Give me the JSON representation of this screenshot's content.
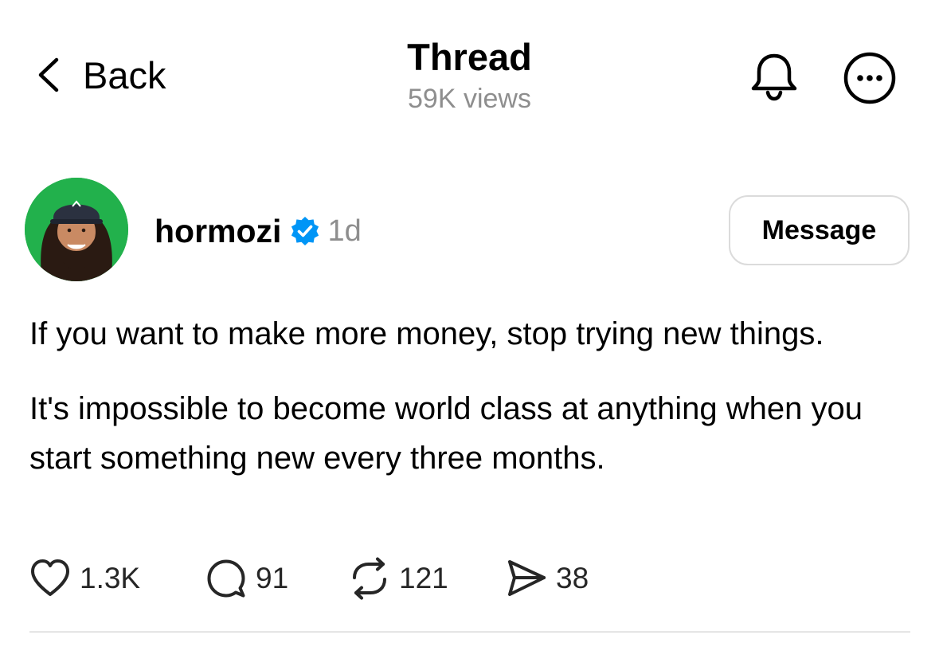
{
  "header": {
    "back_label": "Back",
    "title": "Thread",
    "views": "59K views"
  },
  "post": {
    "username": "hormozi",
    "verified": true,
    "time": "1d",
    "message_button": "Message",
    "paragraphs": [
      "If you want to make more money, stop trying new things.",
      "It's impossible to become world class at anything when you start something new every three months."
    ],
    "stats": {
      "likes": "1.3K",
      "replies": "91",
      "reposts": "121",
      "shares": "38"
    }
  },
  "colors": {
    "verified": "#0095f6",
    "secondary_text": "#8e8e8e",
    "avatar_bg": "#22b14c"
  },
  "icons": [
    "chevron-left-icon",
    "bell-icon",
    "more-icon",
    "verified-badge-icon",
    "heart-icon",
    "comment-icon",
    "repost-icon",
    "share-icon"
  ]
}
